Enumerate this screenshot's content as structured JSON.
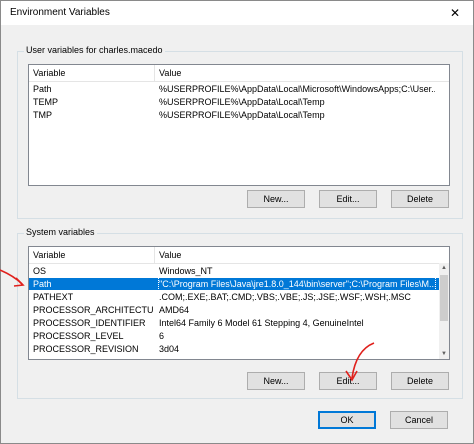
{
  "window": {
    "title": "Environment Variables",
    "close_glyph": "✕"
  },
  "user_section": {
    "label": "User variables for charles.macedo",
    "columns": [
      "Variable",
      "Value"
    ],
    "rows": [
      {
        "variable": "Path",
        "value": "%USERPROFILE%\\AppData\\Local\\Microsoft\\WindowsApps;C:\\User..."
      },
      {
        "variable": "TEMP",
        "value": "%USERPROFILE%\\AppData\\Local\\Temp"
      },
      {
        "variable": "TMP",
        "value": "%USERPROFILE%\\AppData\\Local\\Temp"
      }
    ],
    "buttons": {
      "new": "New...",
      "edit": "Edit...",
      "delete": "Delete"
    }
  },
  "system_section": {
    "label": "System variables",
    "columns": [
      "Variable",
      "Value"
    ],
    "rows": [
      {
        "variable": "OS",
        "value": "Windows_NT"
      },
      {
        "variable": "Path",
        "value": "\"C:\\Program Files\\Java\\jre1.8.0_144\\bin\\server\";C:\\Program Files\\M..."
      },
      {
        "variable": "PATHEXT",
        "value": ".COM;.EXE;.BAT;.CMD;.VBS;.VBE;.JS;.JSE;.WSF;.WSH;.MSC"
      },
      {
        "variable": "PROCESSOR_ARCHITECTURE",
        "value": "AMD64"
      },
      {
        "variable": "PROCESSOR_IDENTIFIER",
        "value": "Intel64 Family 6 Model 61 Stepping 4, GenuineIntel"
      },
      {
        "variable": "PROCESSOR_LEVEL",
        "value": "6"
      },
      {
        "variable": "PROCESSOR_REVISION",
        "value": "3d04"
      }
    ],
    "selected_row": "Path",
    "buttons": {
      "new": "New...",
      "edit": "Edit...",
      "delete": "Delete"
    }
  },
  "footer": {
    "ok": "OK",
    "cancel": "Cancel"
  },
  "colors": {
    "selection": "#0078d7",
    "annotation": "#e0201c"
  },
  "icons": {
    "close": "close-icon",
    "scroll_up": "scroll-up-arrow-icon",
    "scroll_down": "scroll-down-arrow-icon"
  }
}
